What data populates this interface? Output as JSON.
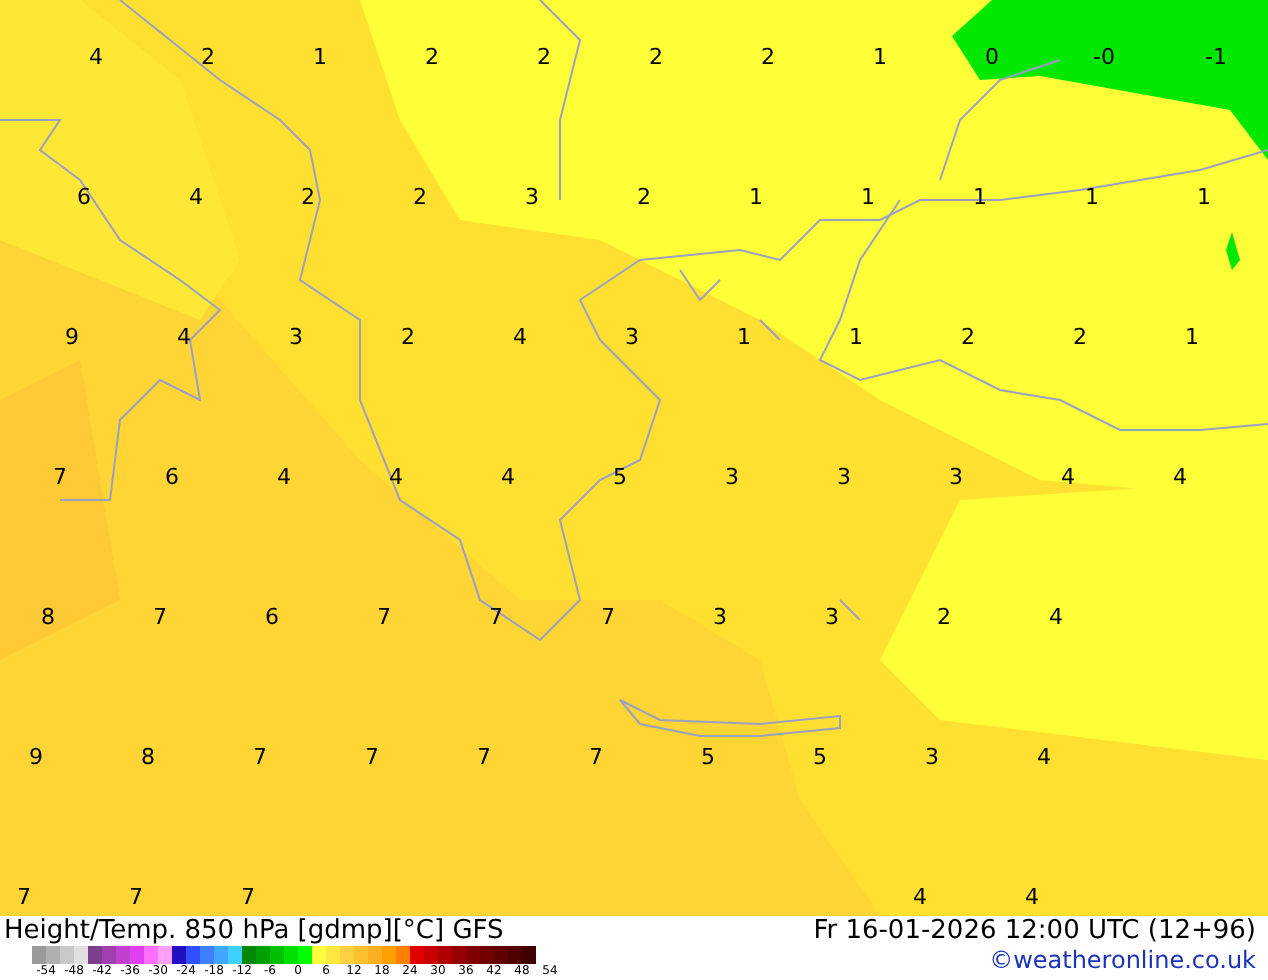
{
  "map": {
    "rows": [
      [
        "4",
        "2",
        "1",
        "2",
        "2",
        "2",
        "2",
        "1",
        "0",
        "-0",
        "-1"
      ],
      [
        "6",
        "4",
        "2",
        "2",
        "3",
        "2",
        "1",
        "1",
        "1",
        "1",
        "1"
      ],
      [
        "9",
        "4",
        "3",
        "2",
        "4",
        "3",
        "1",
        "1",
        "2",
        "2",
        "1"
      ],
      [
        "7",
        "6",
        "4",
        "4",
        "4",
        "5",
        "3",
        "3",
        "3",
        "4",
        "4"
      ],
      [
        "8",
        "7",
        "6",
        "7",
        "7",
        "7",
        "3",
        "3",
        "2",
        "4",
        null
      ],
      [
        "9",
        "8",
        "7",
        "7",
        "7",
        "7",
        "5",
        "5",
        "3",
        "4",
        null
      ],
      [
        "7",
        "7",
        "7",
        null,
        null,
        null,
        null,
        null,
        "4",
        "4",
        null
      ]
    ]
  },
  "footer": {
    "title": "Height/Temp. 850 hPa [gdmp][°C] GFS",
    "datetime": "Fr 16-01-2026 12:00 UTC (12+96)",
    "credit": "©weatheronline.co.uk",
    "scale": {
      "swatches": [
        {
          "color": "#9a9a9a"
        },
        {
          "color": "#b0b0b0"
        },
        {
          "color": "#c8c8c8"
        },
        {
          "color": "#e0e0e0"
        },
        {
          "color": "#7f3f8f"
        },
        {
          "color": "#a040b0"
        },
        {
          "color": "#c040d0"
        },
        {
          "color": "#e040f0"
        },
        {
          "color": "#ff70ff"
        },
        {
          "color": "#ffa0ff"
        },
        {
          "color": "#2010c0"
        },
        {
          "color": "#3050ff"
        },
        {
          "color": "#4080ff"
        },
        {
          "color": "#40a8ff"
        },
        {
          "color": "#40d0ff"
        },
        {
          "color": "#008800"
        },
        {
          "color": "#00a000"
        },
        {
          "color": "#00c000"
        },
        {
          "color": "#00e000"
        },
        {
          "color": "#00ff00"
        },
        {
          "color": "#ffff40"
        },
        {
          "color": "#ffe840"
        },
        {
          "color": "#ffd040"
        },
        {
          "color": "#ffc030"
        },
        {
          "color": "#ffb020"
        },
        {
          "color": "#ffa000"
        },
        {
          "color": "#ff8000"
        },
        {
          "color": "#e00000"
        },
        {
          "color": "#c80000"
        },
        {
          "color": "#b00000"
        },
        {
          "color": "#980000"
        },
        {
          "color": "#800000"
        },
        {
          "color": "#700000"
        },
        {
          "color": "#600000"
        },
        {
          "color": "#500000"
        },
        {
          "color": "#400000"
        }
      ],
      "ticks": [
        "-54",
        "-48",
        "-42",
        "-36",
        "-30",
        "-24",
        "-18",
        "-12",
        "-6",
        "0",
        "6",
        "12",
        "18",
        "24",
        "30",
        "36",
        "42",
        "48",
        "54"
      ]
    }
  }
}
